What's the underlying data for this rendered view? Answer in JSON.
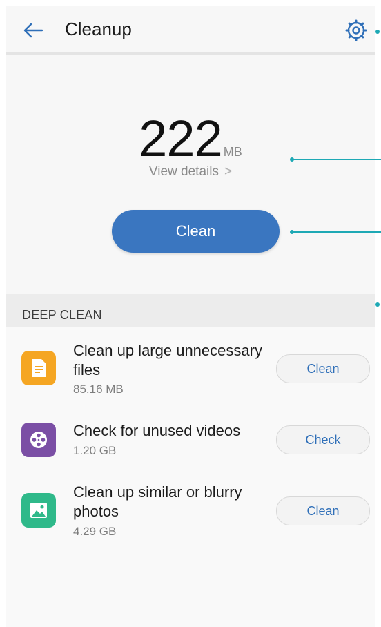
{
  "header": {
    "title": "Cleanup"
  },
  "storage": {
    "value": "222",
    "unit": "MB",
    "view_details": "View details",
    "clean_label": "Clean"
  },
  "deep_clean": {
    "section_title": "DEEP CLEAN",
    "items": [
      {
        "title": "Clean up large unnecessary files",
        "size": "85.16 MB",
        "action": "Clean",
        "icon": "document-icon",
        "color": "#f5a623"
      },
      {
        "title": "Check for unused videos",
        "size": "1.20 GB",
        "action": "Check",
        "icon": "film-reel-icon",
        "color": "#7b4fa5"
      },
      {
        "title": "Clean up similar or blurry photos",
        "size": "4.29 GB",
        "action": "Clean",
        "icon": "photo-icon",
        "color": "#2fb98a"
      }
    ]
  },
  "colors": {
    "accent": "#3a76c0",
    "callout": "#1ea9b5"
  }
}
